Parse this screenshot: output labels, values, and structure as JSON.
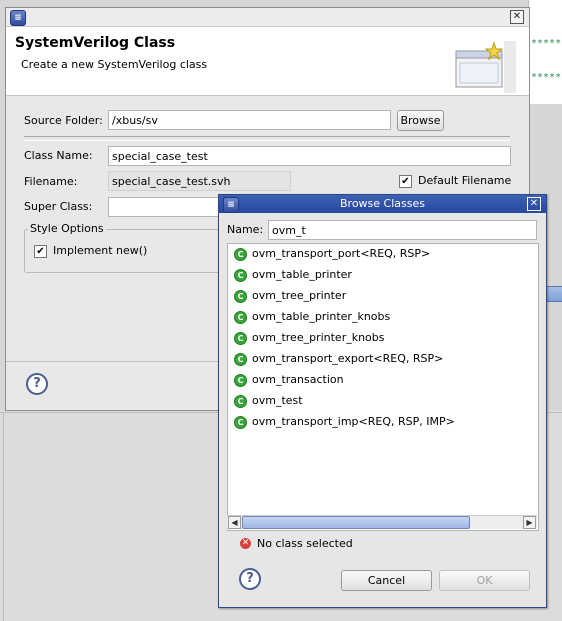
{
  "background": {
    "editor_star_lines": [
      "*****",
      "*****"
    ]
  },
  "main_dialog": {
    "title": "SystemVerilog Class",
    "description": "Create a new SystemVerilog class",
    "source_folder": {
      "label": "Source Folder:",
      "value": "/xbus/sv",
      "browse_label": "Browse"
    },
    "class_name": {
      "label": "Class Name:",
      "value": "special_case_test"
    },
    "filename": {
      "label": "Filename:",
      "value": "special_case_test.svh",
      "checkbox_label": "Default Filename",
      "checked": true
    },
    "super_class": {
      "label": "Super Class:",
      "value": ""
    },
    "style_options": {
      "label": "Style Options",
      "implement_new_label": "Implement new()",
      "checked": true
    }
  },
  "browse_dialog": {
    "title": "Browse Classes",
    "name_label": "Name:",
    "name_value": "ovm_t",
    "classes": [
      "ovm_transport_port<REQ, RSP>",
      "ovm_table_printer",
      "ovm_tree_printer",
      "ovm_table_printer_knobs",
      "ovm_tree_printer_knobs",
      "ovm_transport_export<REQ, RSP>",
      "ovm_transaction",
      "ovm_test",
      "ovm_transport_imp<REQ, RSP, IMP>"
    ],
    "status": "No class selected",
    "cancel_label": "Cancel",
    "ok_label": "OK"
  }
}
